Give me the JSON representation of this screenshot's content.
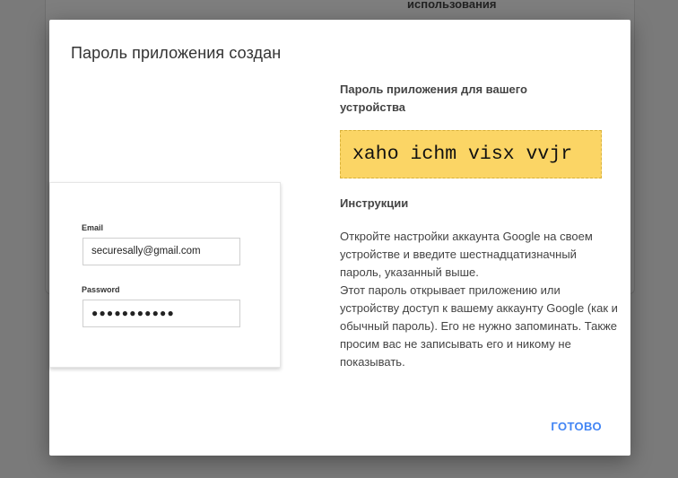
{
  "background": {
    "partial_text": "использования"
  },
  "dialog": {
    "title": "Пароль приложения создан",
    "mock_login": {
      "email_label": "Email",
      "email_value": "securesally@gmail.com",
      "password_label": "Password",
      "password_value": "●●●●●●●●●●●"
    },
    "password_section": {
      "heading": "Пароль приложения для вашего устройства",
      "password": "xaho ichm visx vvjr"
    },
    "instructions_section": {
      "heading": "Инструкции",
      "paragraph1": "Откройте настройки аккаунта Google на своем устройстве и введите шестнадцатизначный пароль, указанный выше.",
      "paragraph2": "Этот пароль открывает приложению или устройству доступ к вашему аккаунту Google (как и обычный пароль). Его не нужно запоминать. Также просим вас не записывать его и никому не показывать."
    },
    "done_label": "ГОТОВО"
  },
  "colors": {
    "accent": "#4285f4",
    "password_highlight": "#fbd565",
    "overlay": "#7a7a7a"
  }
}
